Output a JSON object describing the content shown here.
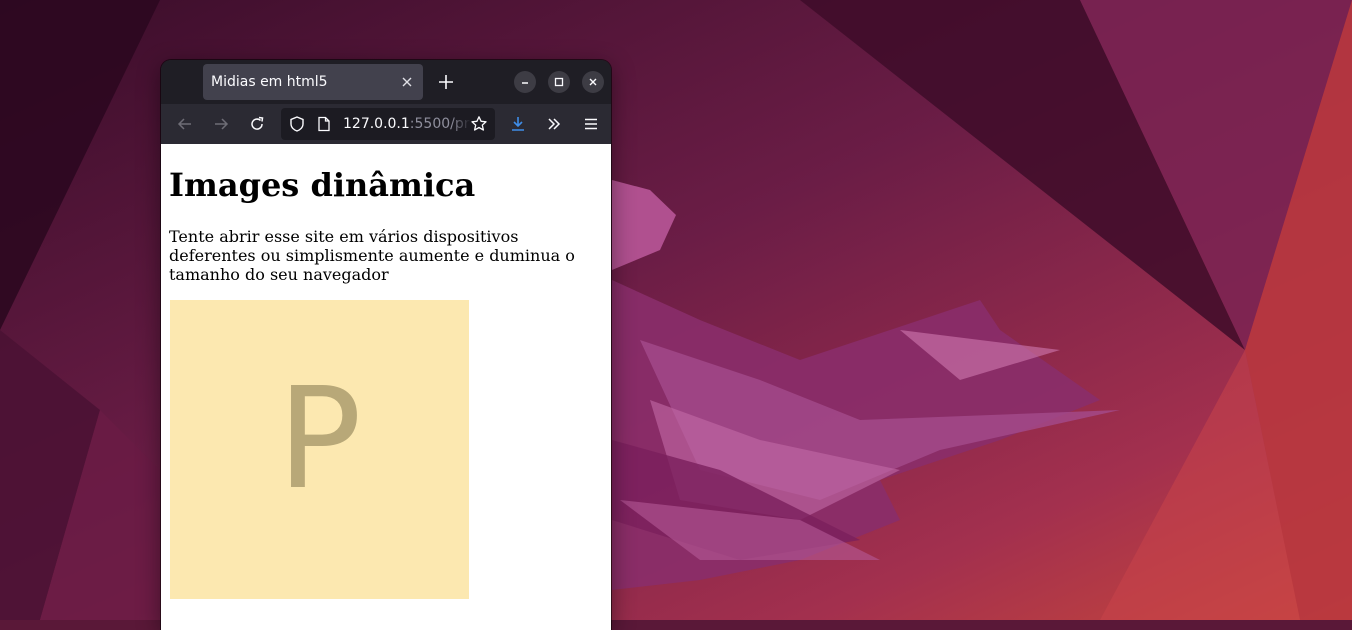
{
  "browser": {
    "tab": {
      "title": "Midias em html5"
    },
    "url": {
      "host": "127.0.0.1",
      "rest": ":5500/pr"
    }
  },
  "page": {
    "heading": "Images dinâmica",
    "paragraph": "Tente abrir esse site em vários dispositivos deferentes ou simplismente aumente e duminua o tamanho do seu navegador",
    "image": {
      "letter": "P",
      "background": "#fce8b0",
      "letter_color": "#b8a878"
    }
  },
  "icons": {
    "tab_close": "close-icon",
    "new_tab": "plus-icon",
    "minimize": "minimize-icon",
    "maximize": "maximize-icon",
    "close_window": "close-icon",
    "back": "arrow-left-icon",
    "forward": "arrow-right-icon",
    "reload": "reload-icon",
    "tracking_protection": "shield-icon",
    "page_info": "page-icon",
    "bookmark": "star-icon",
    "downloads": "download-icon",
    "overflow": "chevron-double-right-icon",
    "menu": "hamburger-menu-icon"
  },
  "colors": {
    "toolbar": "#2b2a33",
    "titlebar": "#1f1e25",
    "accent_download": "#3f8de8",
    "wallpaper_base": "#5a1838"
  }
}
